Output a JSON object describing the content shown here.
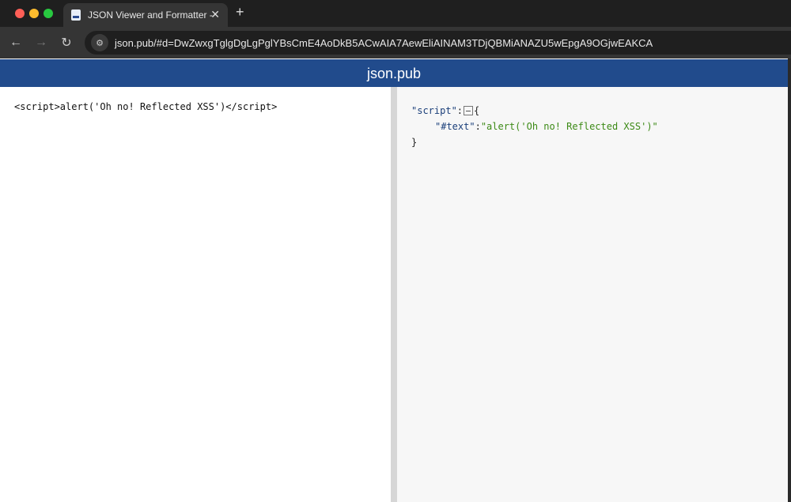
{
  "browser": {
    "tab_title": "JSON Viewer and Formatter -",
    "url": "json.pub/#d=DwZwxgTglgDgLgPglYBsCmE4AoDkB5ACwAIA7AewEliAINAM3TDjQBMiANAZU5wEpgA9OGjwEAKCA"
  },
  "header": {
    "title": "json.pub"
  },
  "input": {
    "text": "<script>alert('Oh no! Reflected XSS')</script>"
  },
  "tree": {
    "key": "\"script\"",
    "colon": ":",
    "open": "{",
    "child_key": "\"#text\"",
    "child_value": "\"alert('Oh no! Reflected XSS')\"",
    "close": "}"
  }
}
